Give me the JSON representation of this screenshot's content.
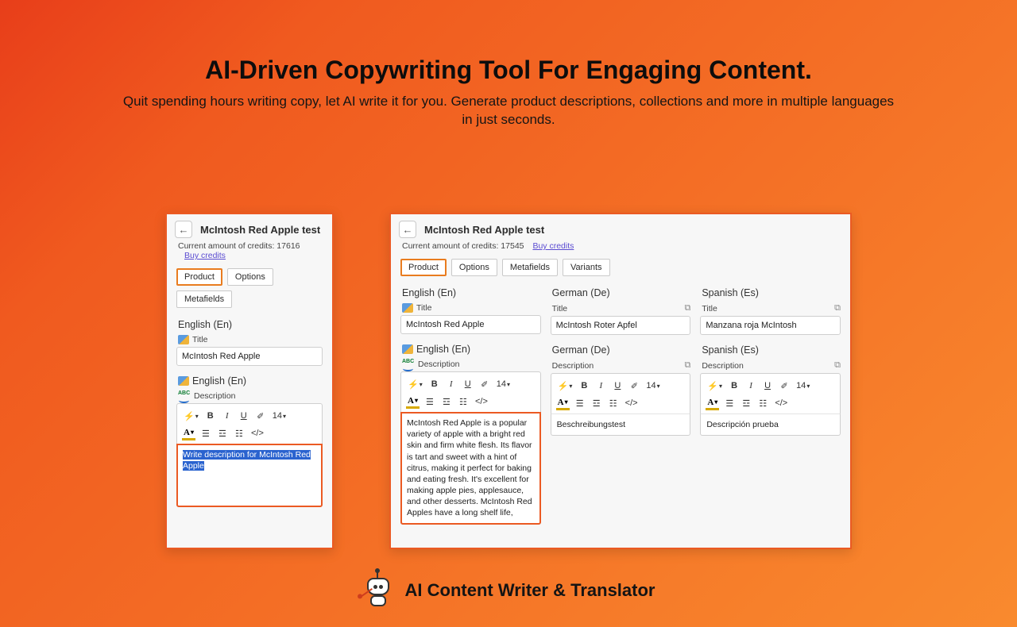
{
  "headline": "AI-Driven Copywriting Tool For Engaging Content.",
  "subhead": "Quit spending hours writing copy, let AI write it for you. Generate product descriptions, collections and more in multiple languages in just seconds.",
  "brand": "AI Content Writer & Translator",
  "panelA": {
    "title": "McIntosh Red Apple test",
    "credits_label": "Current amount of credits: 17616",
    "buy": "Buy credits",
    "tabs": [
      "Product",
      "Options",
      "Metafields"
    ],
    "lang": "English (En)",
    "title_label": "Title",
    "title_value": "McIntosh Red Apple",
    "desc_label": "Description",
    "font_size": "14",
    "prompt": "Write description for McIntosh Red Apple"
  },
  "panelB": {
    "title": "McIntosh Red Apple test",
    "credits_label": "Current amount of credits: 17545",
    "buy": "Buy credits",
    "tabs": [
      "Product",
      "Options",
      "Metafields",
      "Variants"
    ],
    "font_size": "14",
    "cols": {
      "en": {
        "lang": "English (En)",
        "title_label": "Title",
        "title_value": "McIntosh Red Apple",
        "desc_label": "Description",
        "desc": "McIntosh Red Apple is a popular variety of apple with a bright red skin and firm white flesh. Its flavor is tart and sweet with a hint of citrus, making it perfect for baking and eating fresh. It's excellent for making apple pies, applesauce, and other desserts. McIntosh Red Apples have a long shelf life,"
      },
      "de": {
        "lang": "German (De)",
        "title_label": "Title",
        "title_value": "McIntosh Roter Apfel",
        "desc_label": "Description",
        "desc": "Beschreibungstest"
      },
      "es": {
        "lang": "Spanish (Es)",
        "title_label": "Title",
        "title_value": "Manzana roja McIntosh",
        "desc_label": "Description",
        "desc": "Descripción prueba"
      }
    }
  }
}
